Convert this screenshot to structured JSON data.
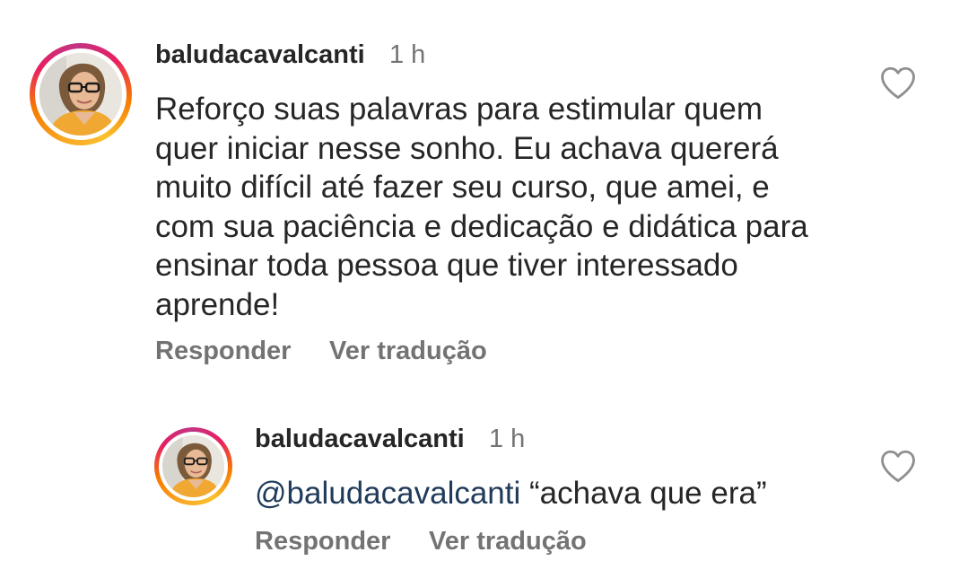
{
  "comment": {
    "username": "baludacavalcanti",
    "time": "1 h",
    "lines": [
      "Reforço suas palavras para estimular quem",
      "quer iniciar nesse sonho. Eu achava quererá",
      "muito difícil até fazer seu curso, que amei, e",
      "com sua paciência e dedicação e didática para",
      "ensinar toda pessoa que tiver interessado",
      "aprende!"
    ],
    "reply_label": "Responder",
    "translate_label": "Ver tradução"
  },
  "reply": {
    "username": "baludacavalcanti",
    "time": "1 h",
    "mention": "@baludacavalcanti",
    "text": " “achava que era”",
    "reply_label": "Responder",
    "translate_label": "Ver tradução"
  },
  "colors": {
    "text": "#262626",
    "secondary": "#737373",
    "mention": "#1f3a5a",
    "ring_start": "#f9a825",
    "ring_end": "#c13584"
  },
  "icons": {
    "like": "heart-outline-icon",
    "avatar": "profile-photo"
  }
}
